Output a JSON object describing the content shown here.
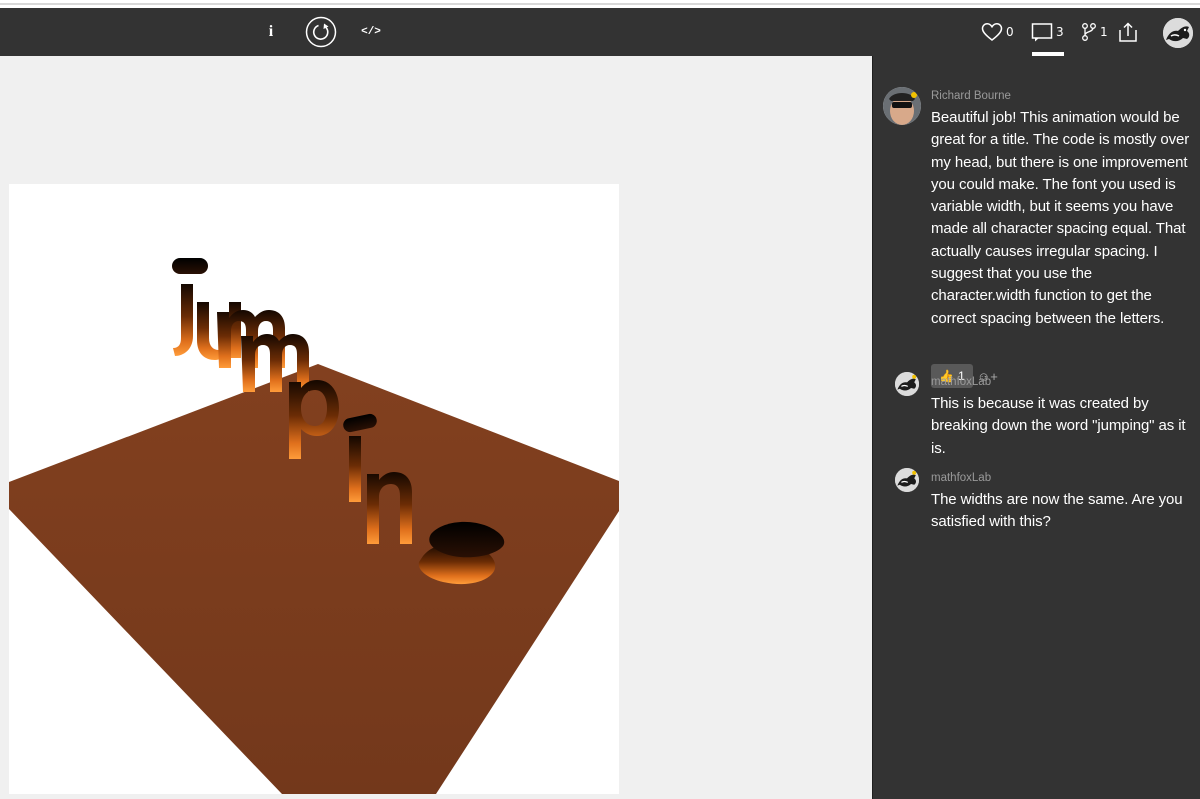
{
  "toolbar": {
    "info_label": "i",
    "code_label": "</>",
    "likes": "0",
    "comments": "3",
    "forks": "1",
    "icons": [
      "info-icon",
      "restart-icon",
      "code-icon",
      "heart-icon",
      "comment-icon",
      "fork-icon",
      "share-icon"
    ]
  },
  "comments": [
    {
      "author": "Richard Bourne",
      "text": "Beautiful job! This animation would be great for a title. The code is mostly over my head, but there is one improvement you could make. The font you used is variable width, but it seems you have made all character spacing equal. That actually causes irregular spacing. I suggest that you use the character.width function to get the correct spacing between the letters.",
      "reaction_emoji": "👍",
      "reaction_count": "1",
      "add_reaction_label": "☺+"
    },
    {
      "author": "mathfoxLab",
      "text": "This is because it was created by breaking down the word \"jumping\" as it is."
    },
    {
      "author": "mathfoxLab",
      "text": "The widths are now the same. Are you satisfied with this?"
    }
  ],
  "colors": {
    "toolbar_bg": "#333333",
    "panel_bg": "#333333",
    "floor": "#7a3b1e",
    "letter_glow": "#ff8a2a",
    "letter_dark": "#1a0a02"
  }
}
